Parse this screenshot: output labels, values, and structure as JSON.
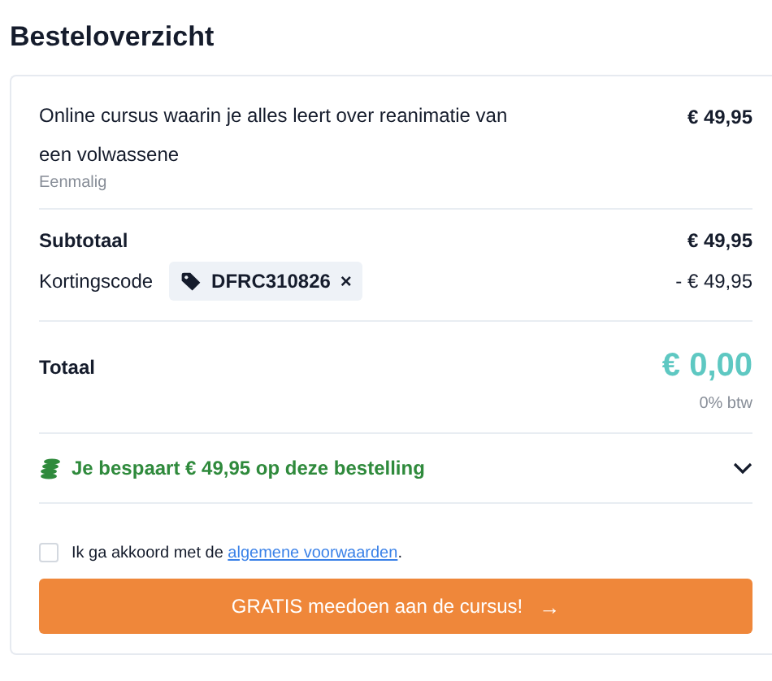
{
  "title": "Besteloverzicht",
  "item": {
    "name": "Online cursus waarin je alles leert over reanimatie van een volwassene",
    "price": "€ 49,95",
    "billing": "Eenmalig"
  },
  "subtotal": {
    "label": "Subtotaal",
    "value": "€ 49,95"
  },
  "discount": {
    "label": "Kortingscode",
    "code": "DFRC310826",
    "remove": "×",
    "value": "- € 49,95"
  },
  "total": {
    "label": "Totaal",
    "value": "€ 0,00",
    "tax": "0% btw"
  },
  "savings": {
    "text": "Je bespaart € 49,95 op deze bestelling",
    "expanded": false
  },
  "agreement": {
    "checked": false,
    "before": "Ik ga akkoord met de ",
    "link": "algemene voorwaarden",
    "after": "."
  },
  "button": {
    "label": "GRATIS meedoen aan de cursus!",
    "arrow": "→"
  }
}
